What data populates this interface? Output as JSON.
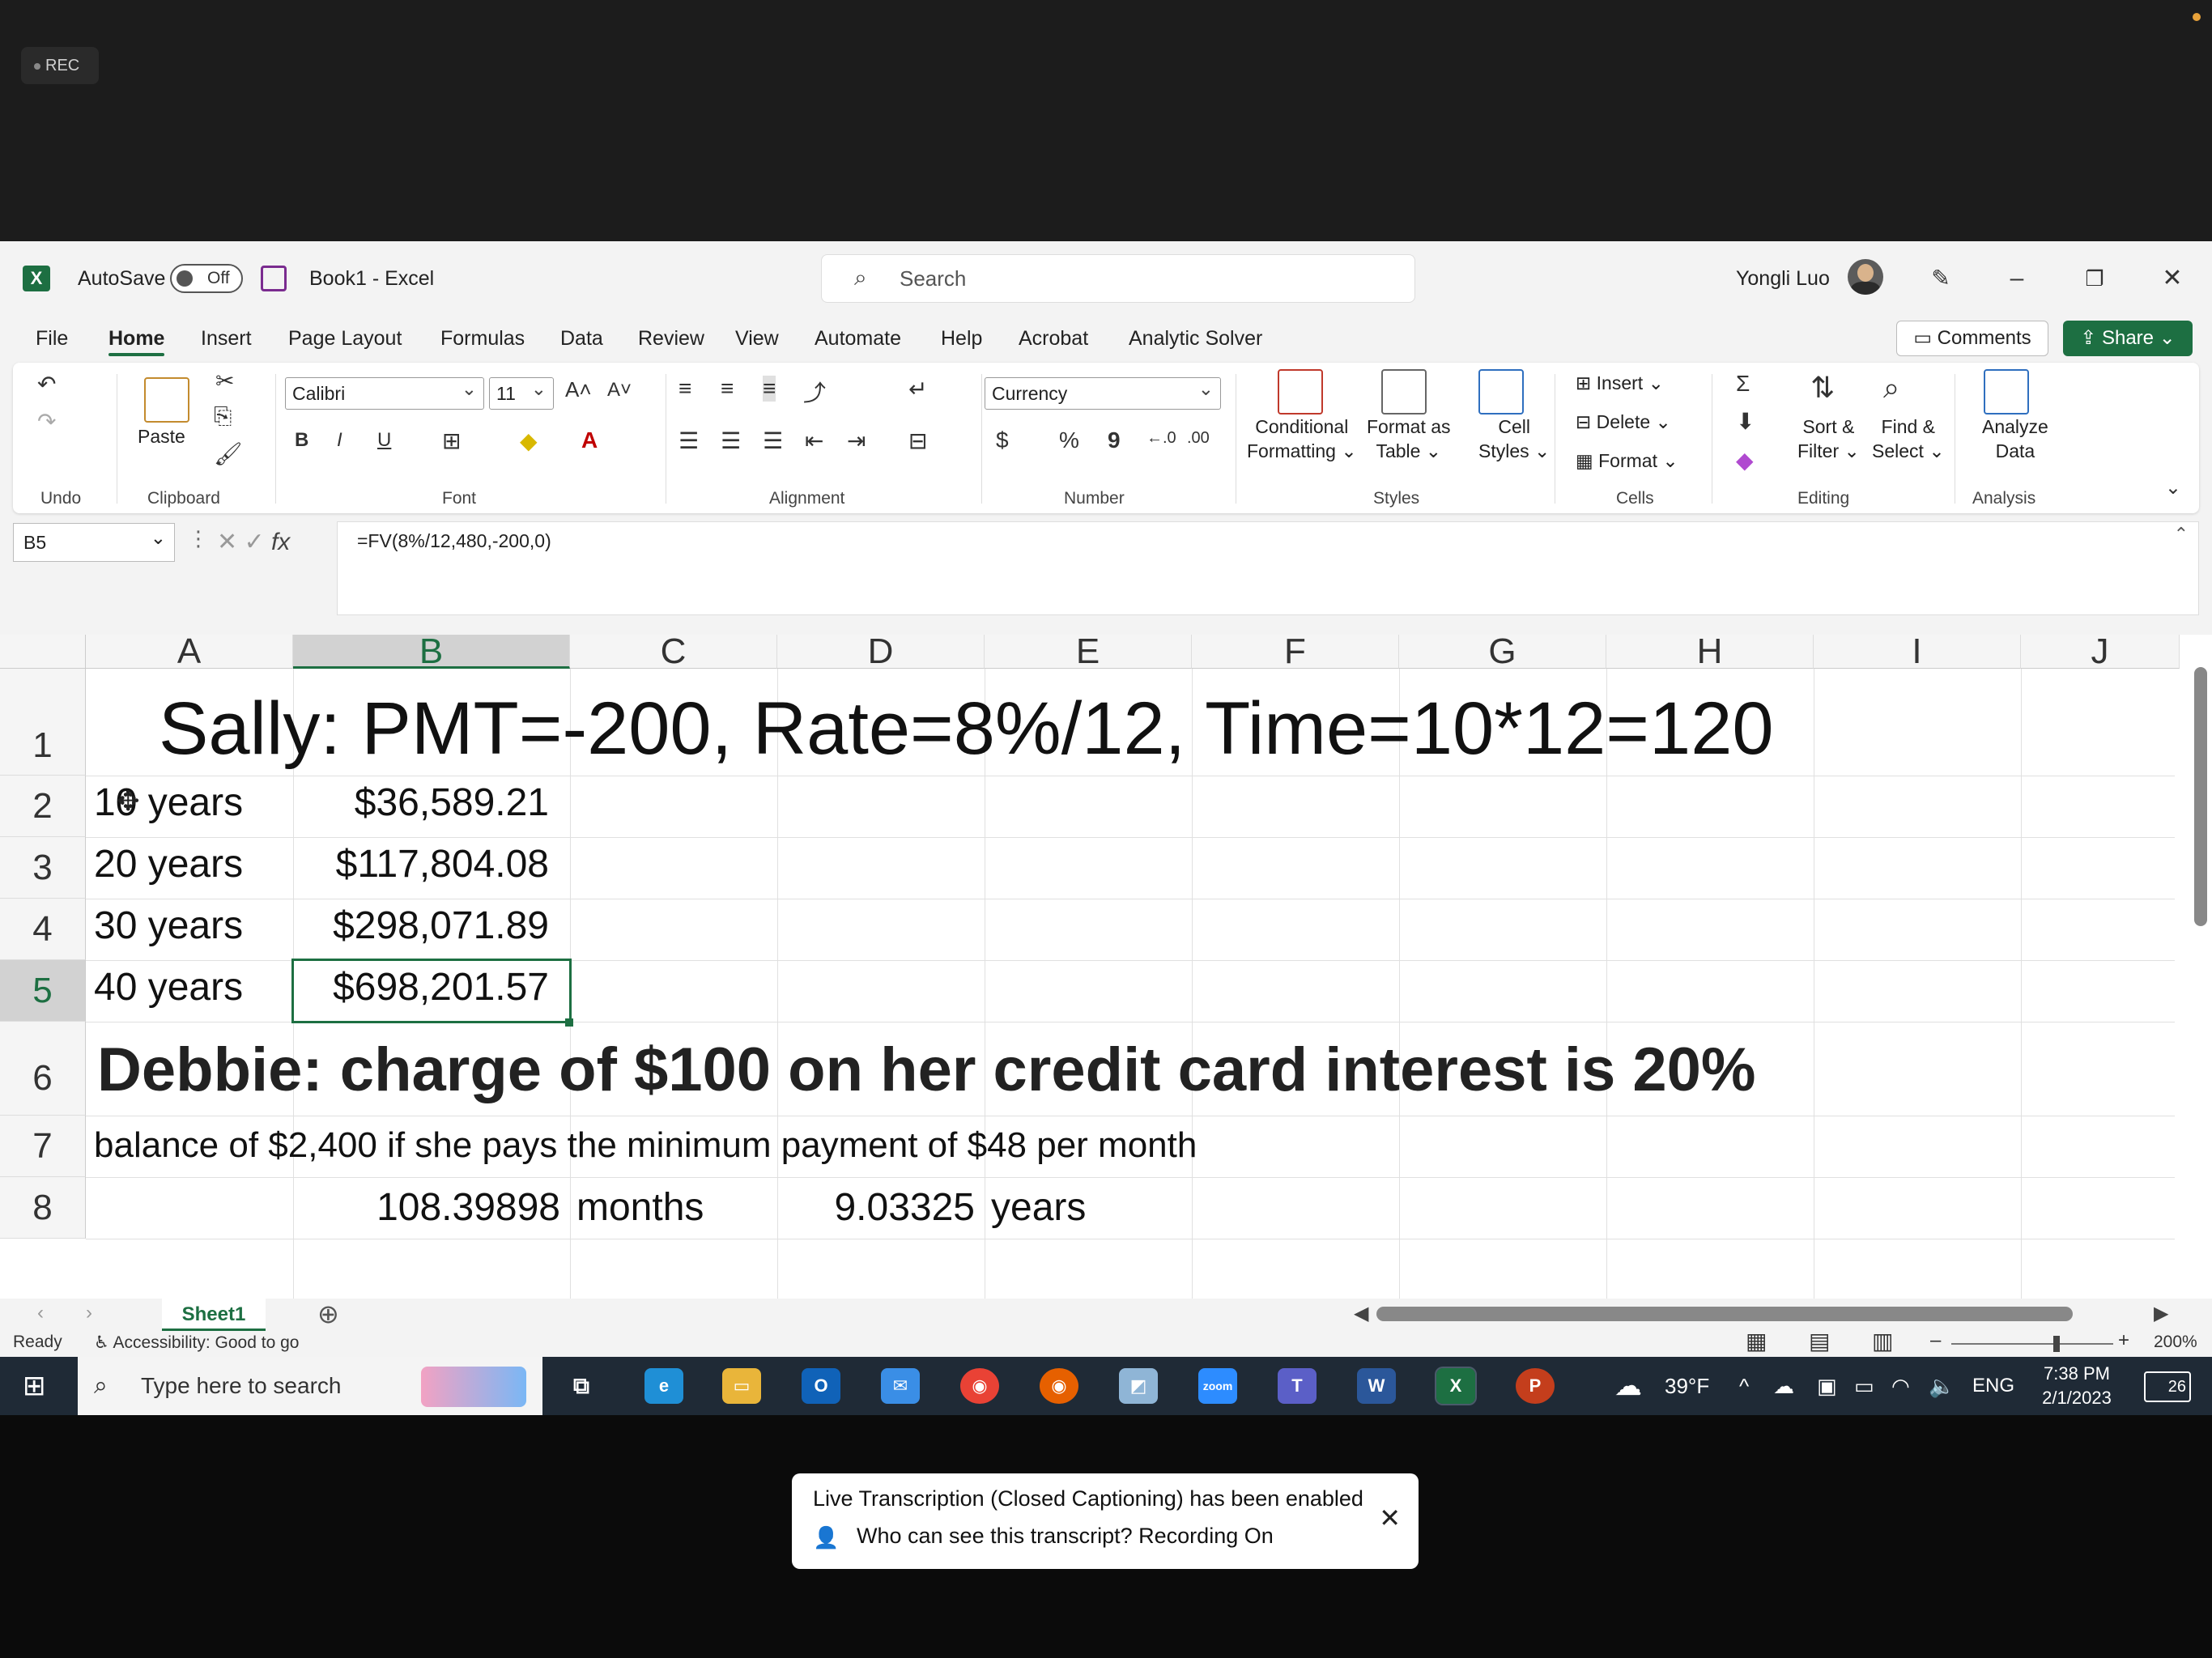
{
  "zoom": {
    "rec_label": "REC"
  },
  "titlebar": {
    "autosave_label": "AutoSave",
    "autosave_state": "Off",
    "doc_title": "Book1  -  Excel",
    "search_placeholder": "Search",
    "user_name": "Yongli Luo"
  },
  "menu": {
    "items": [
      "File",
      "Home",
      "Insert",
      "Page Layout",
      "Formulas",
      "Data",
      "Review",
      "View",
      "Automate",
      "Help",
      "Acrobat",
      "Analytic Solver"
    ],
    "active": "Home",
    "comments_label": "Comments",
    "share_label": "Share"
  },
  "ribbon": {
    "undo_group": "Undo",
    "clipboard_group": "Clipboard",
    "paste_label": "Paste",
    "font_group": "Font",
    "font_name": "Calibri",
    "font_size": "11",
    "alignment_group": "Alignment",
    "number_group": "Number",
    "number_format": "Currency",
    "styles_group": "Styles",
    "conditional_formatting": "Conditional\nFormatting",
    "format_as_table": "Format as\nTable",
    "cell_styles": "Cell\nStyles",
    "cells_group": "Cells",
    "insert_label": "Insert",
    "delete_label": "Delete",
    "format_label": "Format",
    "editing_group": "Editing",
    "sort_filter": "Sort &\nFilter",
    "find_select": "Find &\nSelect",
    "analysis_group": "Analysis",
    "analyze_data": "Analyze\nData"
  },
  "formula_bar": {
    "name_box": "B5",
    "formula": "=FV(8%/12,480,-200,0)"
  },
  "grid": {
    "columns": [
      "A",
      "B",
      "C",
      "D",
      "E",
      "F",
      "G",
      "H",
      "I",
      "J"
    ],
    "selected_column": "B",
    "rows": [
      "1",
      "2",
      "3",
      "4",
      "5",
      "6",
      "7",
      "8"
    ],
    "selected_row": "5",
    "r1": "Sally: PMT=-200,  Rate=8%/12,  Time=10*12=120",
    "r2a": "10 years",
    "r2b": "$36,589.21",
    "r3a": "20 years",
    "r3b": "$117,804.08",
    "r4a": "30 years",
    "r4b": "$298,071.89",
    "r5a": "40 years",
    "r5b": "$698,201.57",
    "r6": "Debbie: charge of $100 on her credit card interest is 20%",
    "r7": "balance of $2,400 if she pays the minimum payment of $48 per month",
    "r8b": "108.39898",
    "r8c": "months",
    "r8d": "9.03325",
    "r8e": "years"
  },
  "sheets": {
    "tab": "Sheet1"
  },
  "status": {
    "ready": "Ready",
    "accessibility": "Accessibility: Good to go",
    "zoom_level": "200%"
  },
  "taskbar": {
    "search_placeholder": "Type here to search",
    "weather": "39°F",
    "language": "ENG",
    "time": "7:38 PM",
    "date": "2/1/2023",
    "notification_count": "26"
  },
  "toast": {
    "line1": "Live Transcription (Closed Captioning) has been enabled",
    "line2": "Who can see this transcript? Recording On"
  }
}
